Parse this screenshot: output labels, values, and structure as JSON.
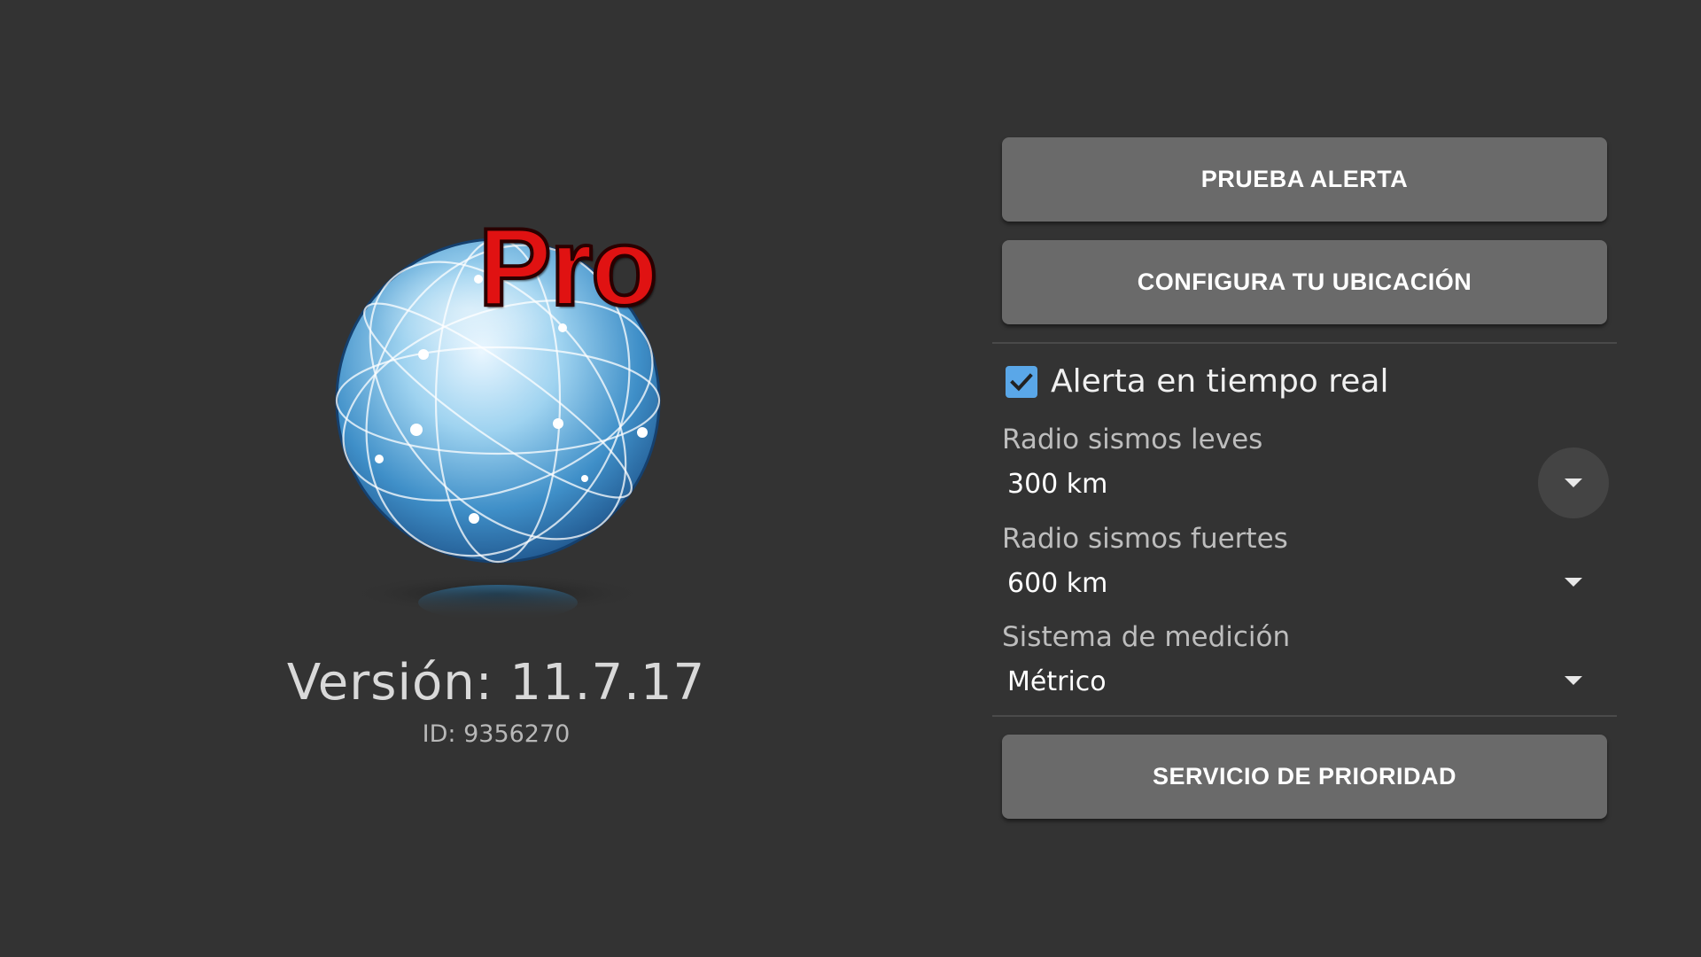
{
  "app": {
    "logo_text": "Pro",
    "version": "Versión: 11.7.17",
    "id": "ID: 9356270"
  },
  "buttons": {
    "test_alert": "PRUEBA ALERTA",
    "set_location": "CONFIGURA TU UBICACIÓN",
    "priority_service": "SERVICIO DE PRIORIDAD"
  },
  "realtime_alert": {
    "label": "Alerta en tiempo real",
    "checked": true
  },
  "settings": {
    "minor_radius": {
      "label": "Radio sismos leves",
      "value": "300 km"
    },
    "strong_radius": {
      "label": "Radio sismos fuertes",
      "value": "600 km"
    },
    "measurement": {
      "label": "Sistema de medición",
      "value": "Métrico"
    }
  },
  "icons": {
    "checkbox": "check-icon",
    "dropdown": "triangle-down-icon",
    "logo": "globe-icon"
  },
  "colors": {
    "background": "#333333",
    "button": "#6a6a6a",
    "checkbox": "#5aa7e8",
    "logo_pro": "#e01212"
  }
}
